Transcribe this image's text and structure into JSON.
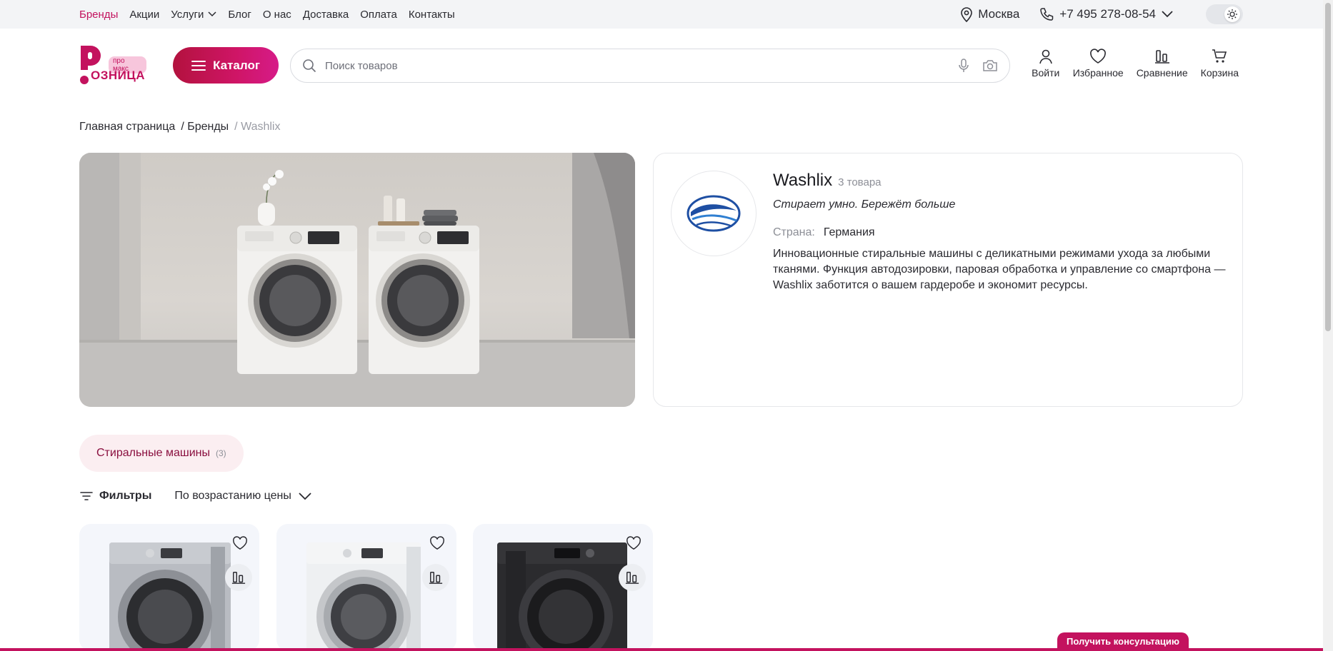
{
  "topnav": [
    {
      "label": "Бренды",
      "active": true
    },
    {
      "label": "Акции"
    },
    {
      "label": "Услуги"
    },
    {
      "label": "Блог"
    },
    {
      "label": "О нас"
    },
    {
      "label": "Доставка"
    },
    {
      "label": "Оплата"
    },
    {
      "label": "Контакты"
    }
  ],
  "topright": {
    "city": "Москва",
    "phone": "+7 495 278-08-54"
  },
  "logo": {
    "name": "ОЗНИЦА",
    "badge": "про макс"
  },
  "header": {
    "catalog_label": "Каталог",
    "search_placeholder": "Поиск товаров",
    "actions": {
      "login": "Войти",
      "favorites": "Избранное",
      "compare": "Сравнение",
      "cart": "Корзина"
    }
  },
  "breadcrumb": {
    "home": "Главная страница",
    "brands": "/ Бренды",
    "current": "/ Washlix"
  },
  "brand": {
    "name": "Washlix",
    "count": "3 товара",
    "slogan": "Стирает умно. Бережёт больше",
    "country_label": "Страна:",
    "country": "Германия",
    "description": "Инновационные стиральные машины с деликатными режимами ухода за любыми тканями. Функция автодозировки, паровая обработка и управление со смартфона — Washlix заботится о вашем гардеробе и экономит ресурсы."
  },
  "category": {
    "label": "Стиральные машины",
    "count": "(3)"
  },
  "toolbar": {
    "filters": "Фильтры",
    "sort": "По возрастанию цены"
  },
  "products": [
    {
      "color": "#b9bcc2"
    },
    {
      "color": "#eef0f2"
    },
    {
      "color": "#2b2b2e"
    }
  ],
  "consult_label": "Получить консультацию",
  "colors": {
    "accent": "#c3125e",
    "chip_bg": "#fbeef1"
  }
}
